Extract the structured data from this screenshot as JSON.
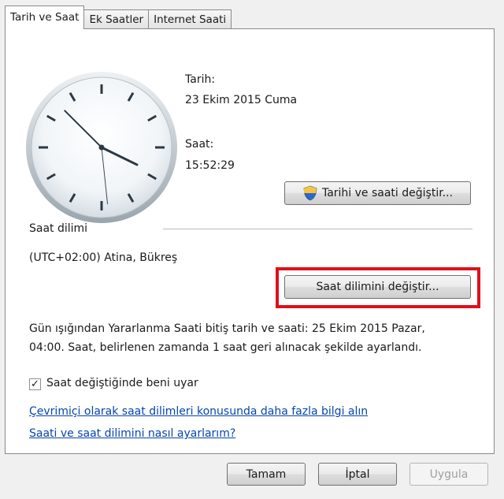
{
  "tabs": [
    {
      "label": "Tarih ve Saat"
    },
    {
      "label": "Ek Saatler"
    },
    {
      "label": "Internet Saati"
    }
  ],
  "clock": {
    "time": "15:52:29"
  },
  "date_section": {
    "date_label": "Tarih:",
    "date_value": "23 Ekim 2015 Cuma",
    "time_label": "Saat:",
    "time_value": "15:52:29",
    "change_datetime_button": "Tarihi ve saati değiştir..."
  },
  "timezone_section": {
    "header": "Saat dilimi",
    "value": "(UTC+02:00) Atina, Bükreş",
    "change_timezone_button": "Saat dilimini değiştir..."
  },
  "dst_info": {
    "line1": "Gün ışığından Yararlanma Saati bitiş tarih ve saati: 25 Ekim 2015 Pazar,",
    "line2": "04:00. Saat, belirlenen zamanda 1 saat geri alınacak şekilde ayarlandı."
  },
  "notify_checkbox": {
    "label": "Saat değiştiğinde beni uyar",
    "checked": true
  },
  "links": {
    "more_info": "Çevrimiçi olarak saat dilimleri konusunda daha fazla bilgi alın",
    "how_to": "Saati ve saat dilimini nasıl ayarlarım?"
  },
  "footer": {
    "ok_button": "Tamam",
    "cancel_button": "İptal",
    "apply_button": "Uygula"
  },
  "colors": {
    "highlight": "#e0101b",
    "link": "#0645ad"
  }
}
